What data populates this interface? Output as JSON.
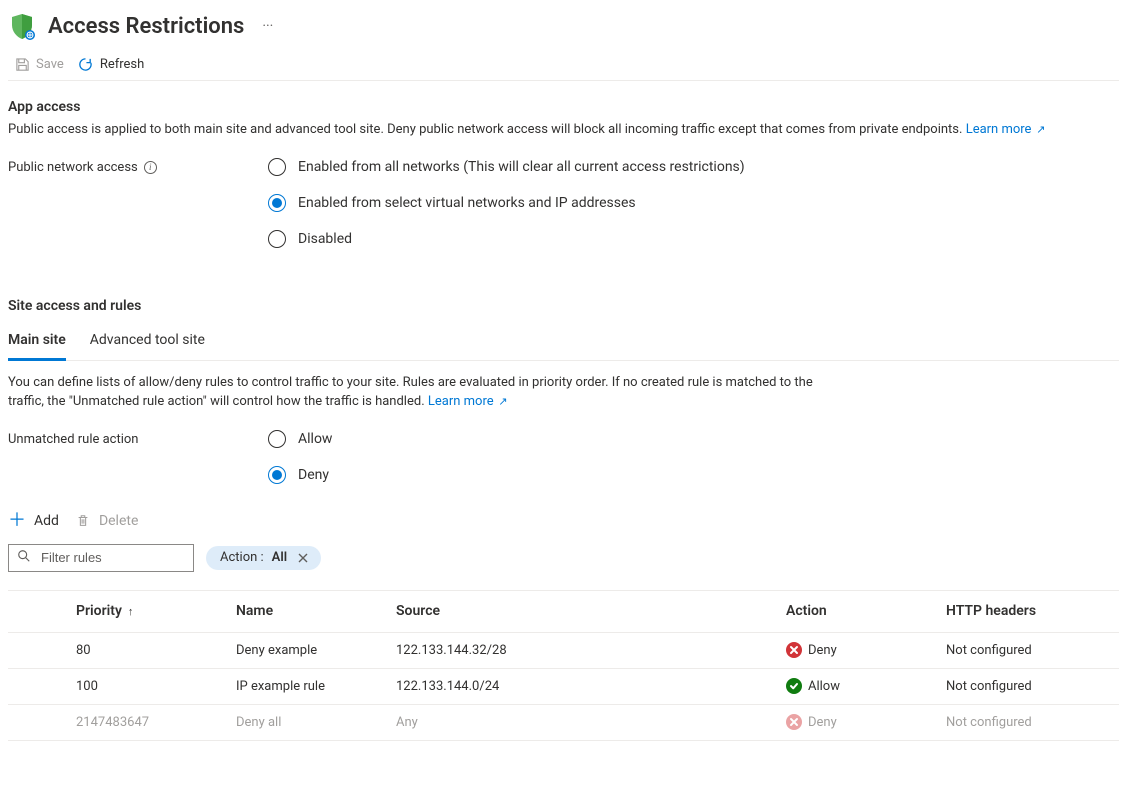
{
  "header": {
    "title": "Access Restrictions"
  },
  "toolbar": {
    "save_label": "Save",
    "refresh_label": "Refresh"
  },
  "app_access": {
    "title": "App access",
    "desc": "Public access is applied to both main site and advanced tool site. Deny public network access will block all incoming traffic except that comes from private endpoints.",
    "learn_more": "Learn more",
    "field_label": "Public network access",
    "options": {
      "all": "Enabled from all networks (This will clear all current access restrictions)",
      "select": "Enabled from select virtual networks and IP addresses",
      "disabled": "Disabled"
    }
  },
  "site_access": {
    "title": "Site access and rules",
    "tabs": {
      "main": "Main site",
      "advanced": "Advanced tool site"
    },
    "desc": "You can define lists of allow/deny rules to control traffic to your site. Rules are evaluated in priority order. If no created rule is matched to the traffic, the \"Unmatched rule action\" will control how the traffic is handled.",
    "learn_more": "Learn more",
    "unmatched_label": "Unmatched rule action",
    "unmatched_options": {
      "allow": "Allow",
      "deny": "Deny"
    }
  },
  "rules_toolbar": {
    "add": "Add",
    "delete": "Delete"
  },
  "filter": {
    "placeholder": "Filter rules",
    "chip_key": "Action :",
    "chip_val": "All"
  },
  "table": {
    "headers": {
      "priority": "Priority",
      "name": "Name",
      "source": "Source",
      "action": "Action",
      "http": "HTTP headers"
    },
    "rows": [
      {
        "priority": "80",
        "name": "Deny example",
        "source": "122.133.144.32/28",
        "action_type": "deny",
        "action": "Deny",
        "http": "Not configured",
        "disabled": false
      },
      {
        "priority": "100",
        "name": "IP example rule",
        "source": "122.133.144.0/24",
        "action_type": "allow",
        "action": "Allow",
        "http": "Not configured",
        "disabled": false
      },
      {
        "priority": "2147483647",
        "name": "Deny all",
        "source": "Any",
        "action_type": "deny",
        "action": "Deny",
        "http": "Not configured",
        "disabled": true
      }
    ]
  }
}
